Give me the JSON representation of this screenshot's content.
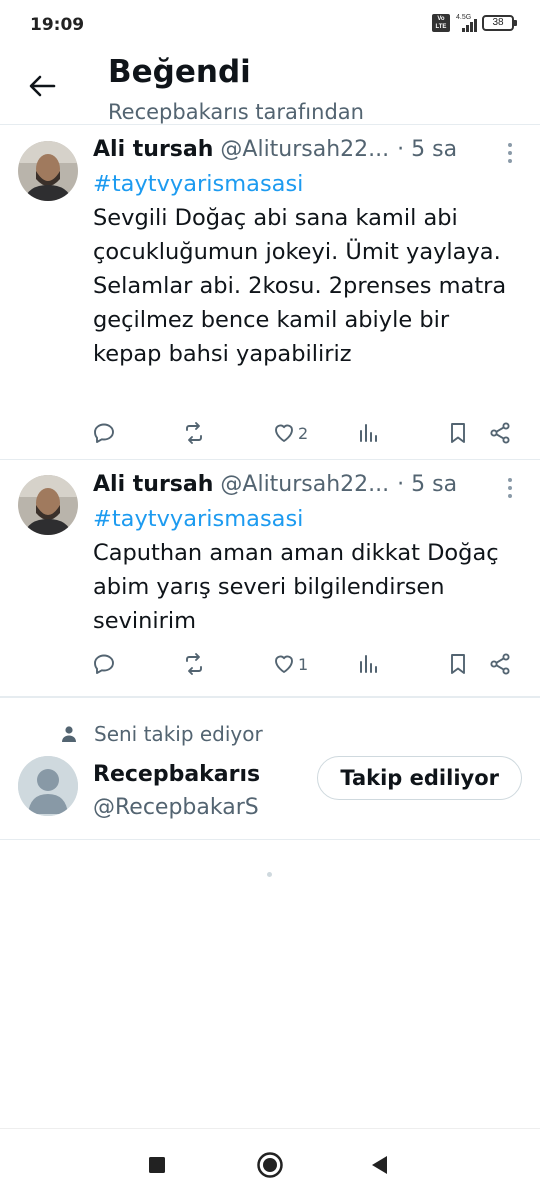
{
  "status_bar": {
    "time": "19:09",
    "volte": "Vo LTE",
    "network": "4.5G",
    "battery": "38"
  },
  "header": {
    "title": "Beğendi",
    "subtitle": "Recepbakarıs tarafından"
  },
  "tweets": [
    {
      "name": "Ali tursah",
      "handle": "@Alitursah22...",
      "time": "· 5 sa",
      "hashtag": "#taytvyarismasasi",
      "text": "Sevgili Doğaç abi sana kamil abi çocukluğumun jokeyi. Ümit yaylaya. Selamlar abi. 2kosu. 2prenses matra geçilmez bence kamil abiyle bir kepap bahsi yapabiliriz",
      "likes": "2"
    },
    {
      "name": "Ali tursah",
      "handle": "@Alitursah22...",
      "time": "· 5 sa",
      "hashtag": "#taytvyarismasasi",
      "text": "Caputhan aman aman dikkat Doğaç abim yarış severi bilgilendirsen sevinirim",
      "likes": "1"
    }
  ],
  "follow_card": {
    "note": "Seni takip ediyor",
    "name": "Recepbakarıs",
    "handle": "@RecepbakarS",
    "button_label": "Takip ediliyor"
  },
  "icons": {
    "back": "arrow-left-icon",
    "more": "more-vertical-icon",
    "reply": "reply-icon",
    "retweet": "retweet-icon",
    "like": "heart-icon",
    "views": "views-icon",
    "bookmark": "bookmark-icon",
    "share": "share-icon",
    "person": "person-icon"
  },
  "colors": {
    "accent": "#1d9bf0",
    "text": "#0f1419",
    "secondary": "#536471"
  }
}
